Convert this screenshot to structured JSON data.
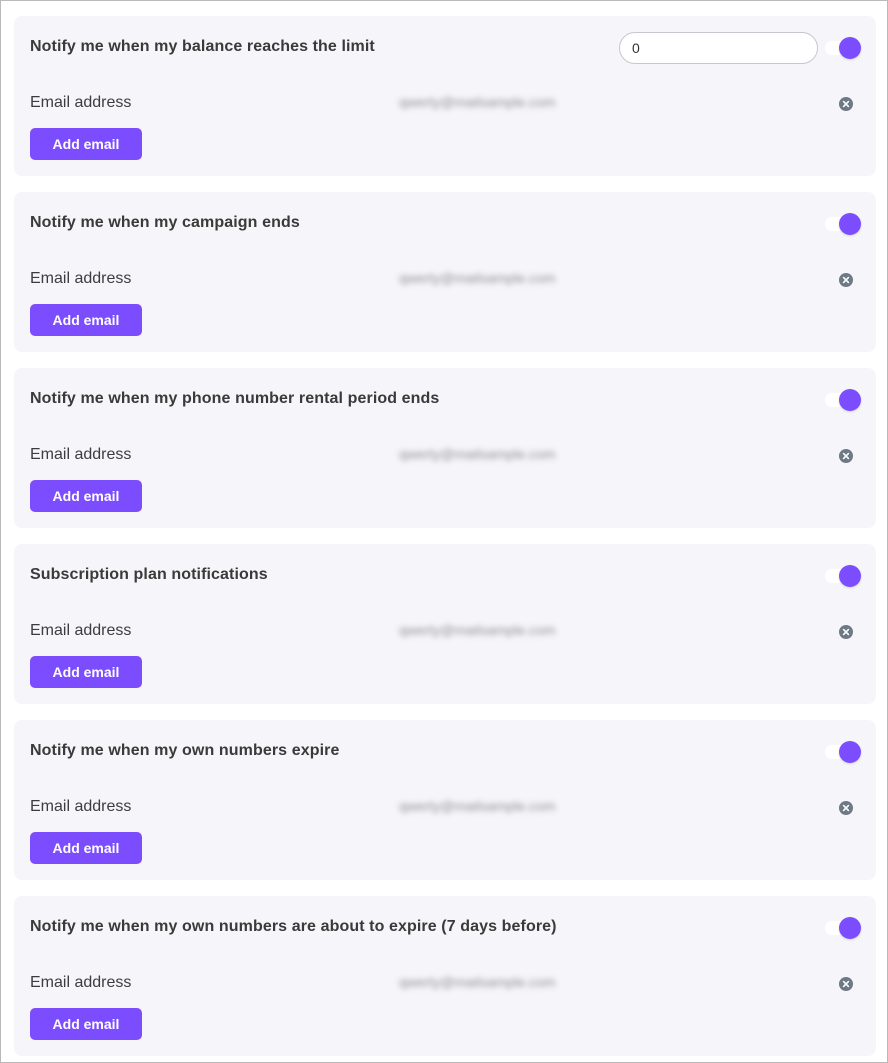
{
  "notifications": [
    {
      "title": "Notify me when my balance reaches the limit",
      "limit_value": "0",
      "enabled": true,
      "email_label": "Email address",
      "email_value": "qwerty@mailsample.com",
      "add_email_label": "Add email"
    },
    {
      "title": "Notify me when my campaign ends",
      "enabled": true,
      "email_label": "Email address",
      "email_value": "qwerty@mailsample.com",
      "add_email_label": "Add email"
    },
    {
      "title": "Notify me when my phone number rental period ends",
      "enabled": true,
      "email_label": "Email address",
      "email_value": "qwerty@mailsample.com",
      "add_email_label": "Add email"
    },
    {
      "title": "Subscription plan notifications",
      "enabled": true,
      "email_label": "Email address",
      "email_value": "qwerty@mailsample.com",
      "add_email_label": "Add email"
    },
    {
      "title": "Notify me when my own numbers expire",
      "enabled": true,
      "email_label": "Email address",
      "email_value": "qwerty@mailsample.com",
      "add_email_label": "Add email"
    },
    {
      "title": "Notify me when my own numbers are about to expire (7 days before)",
      "enabled": true,
      "email_label": "Email address",
      "email_value": "qwerty@mailsample.com",
      "add_email_label": "Add email"
    }
  ],
  "colors": {
    "accent": "#7c4dff",
    "card_bg": "#f6f5f9",
    "remove_icon": "#6c7a86"
  },
  "icons": {
    "remove": "close-circle-icon",
    "toggle": "toggle-switch-on"
  }
}
